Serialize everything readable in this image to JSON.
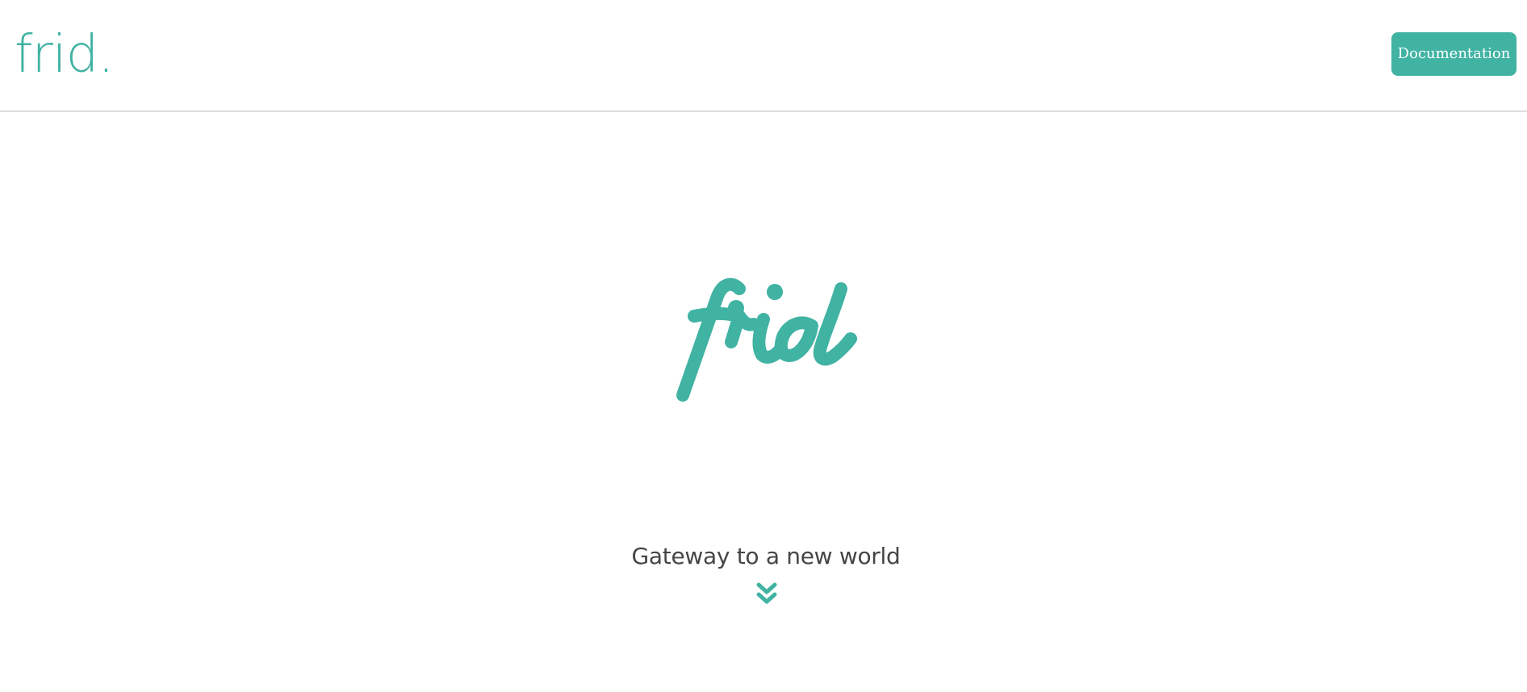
{
  "header": {
    "brand": "frid.",
    "documentation_label": "Documentation"
  },
  "hero": {
    "logo_text": "frid",
    "tagline": "Gateway to a new world",
    "scroll_icon": "double-chevron-down-icon"
  },
  "colors": {
    "accent": "#41b3a3",
    "text": "#454545",
    "divider": "#dedede",
    "background": "#ffffff"
  }
}
